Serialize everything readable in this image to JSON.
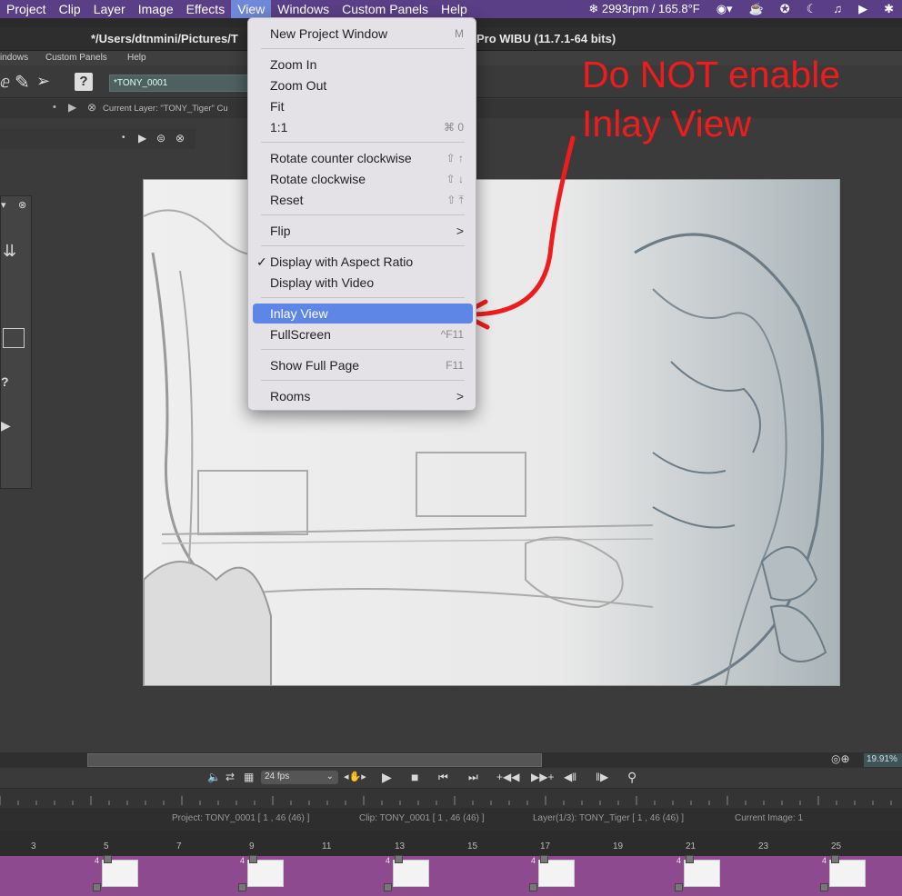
{
  "mac_menubar": {
    "items": [
      "Project",
      "Clip",
      "Layer",
      "Image",
      "Effects",
      "View",
      "Windows",
      "Custom Panels",
      "Help"
    ],
    "active": "View",
    "tray_status": "2993rpm / 165.8°F"
  },
  "window": {
    "title_left": "*/Users/dtnmini/Pictures/T",
    "title_right": "Pro WIBU (11.7.1-64 bits)"
  },
  "app_menu": [
    "indows",
    "Custom Panels",
    "Help"
  ],
  "project_field": "*TONY_0001",
  "current_layer_label": "Current Layer: \"TONY_Tiger\"  Cu",
  "view_menu": {
    "items": [
      {
        "label": "New Project Window",
        "shortcut": "M"
      },
      {
        "label": "Zoom In",
        "shortcut": ""
      },
      {
        "label": "Zoom Out",
        "shortcut": ""
      },
      {
        "label": "Fit",
        "shortcut": ""
      },
      {
        "label": "1:1",
        "shortcut": "⌘ 0"
      },
      {
        "label": "Rotate counter clockwise",
        "shortcut": "⇧ ↑"
      },
      {
        "label": "Rotate clockwise",
        "shortcut": "⇧ ↓"
      },
      {
        "label": "Reset",
        "shortcut": "⇧ ⤒"
      },
      {
        "label": "Flip",
        "shortcut": ">"
      },
      {
        "label": "Display with Aspect Ratio",
        "shortcut": "",
        "checked": true
      },
      {
        "label": "Display with Video",
        "shortcut": ""
      },
      {
        "label": "Inlay View",
        "shortcut": "",
        "highlighted": true
      },
      {
        "label": "FullScreen",
        "shortcut": "^F11"
      },
      {
        "label": "Show Full Page",
        "shortcut": "F11"
      },
      {
        "label": "Rooms",
        "shortcut": ">"
      }
    ],
    "checkmark": "✓"
  },
  "annotation": {
    "line1": "Do NOT enable",
    "line2": "Inlay View",
    "color": "#ee1c1c"
  },
  "zoom": "19.91%",
  "fps": "24 fps",
  "info": {
    "project": "Project: TONY_0001 [ 1 , 46  (46) ]",
    "clip": "Clip: TONY_0001 [ 1 , 46  (46) ]",
    "layer": "Layer(1/3): TONY_Tiger [ 1 , 46  (46) ]",
    "current_image": "Current Image: 1"
  },
  "frame_numbers": [
    "3",
    "5",
    "7",
    "9",
    "11",
    "13",
    "15",
    "17",
    "19",
    "21",
    "23",
    "25"
  ],
  "key_marks": [
    "4",
    "4",
    "4",
    "4",
    "4",
    "4"
  ]
}
